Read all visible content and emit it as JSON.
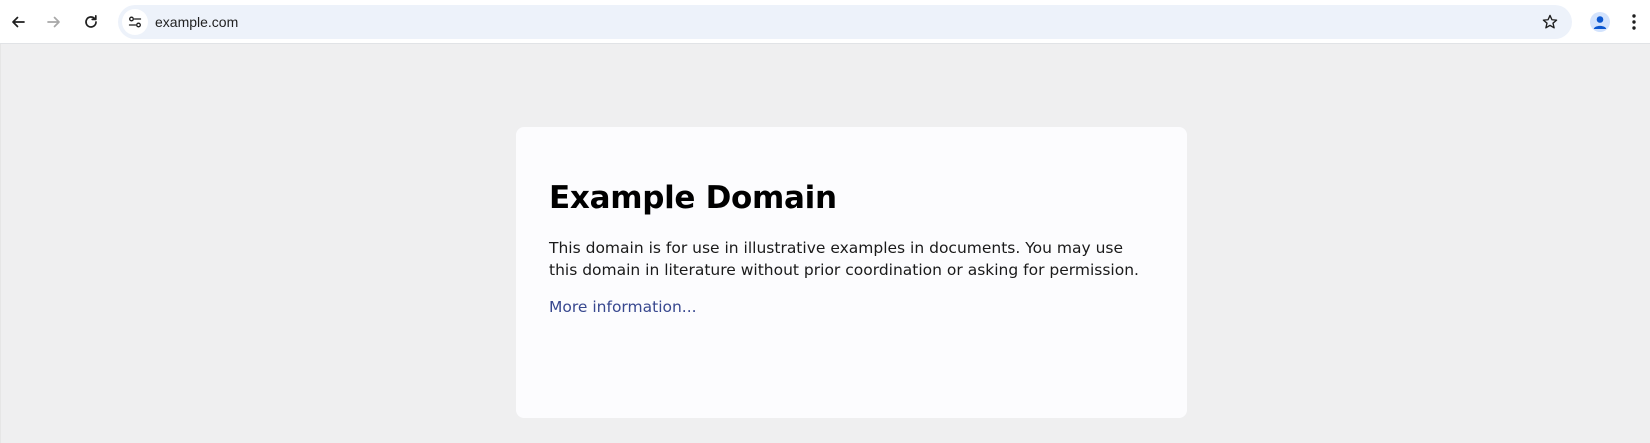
{
  "browser": {
    "url": "example.com",
    "icons": {
      "back": "back-arrow-icon",
      "forward": "forward-arrow-icon",
      "reload": "reload-icon",
      "site_info": "tune-icon",
      "bookmark": "star-icon",
      "profile": "person-icon",
      "menu": "kebab-menu-icon"
    }
  },
  "page": {
    "title": "Example Domain",
    "description": "This domain is for use in illustrative examples in documents. You may use this domain in literature without prior coordination or asking for permission.",
    "link_text": "More information...",
    "colors": {
      "background": "#efeff0",
      "card": "#fcfcfe",
      "link": "#38488f"
    }
  }
}
